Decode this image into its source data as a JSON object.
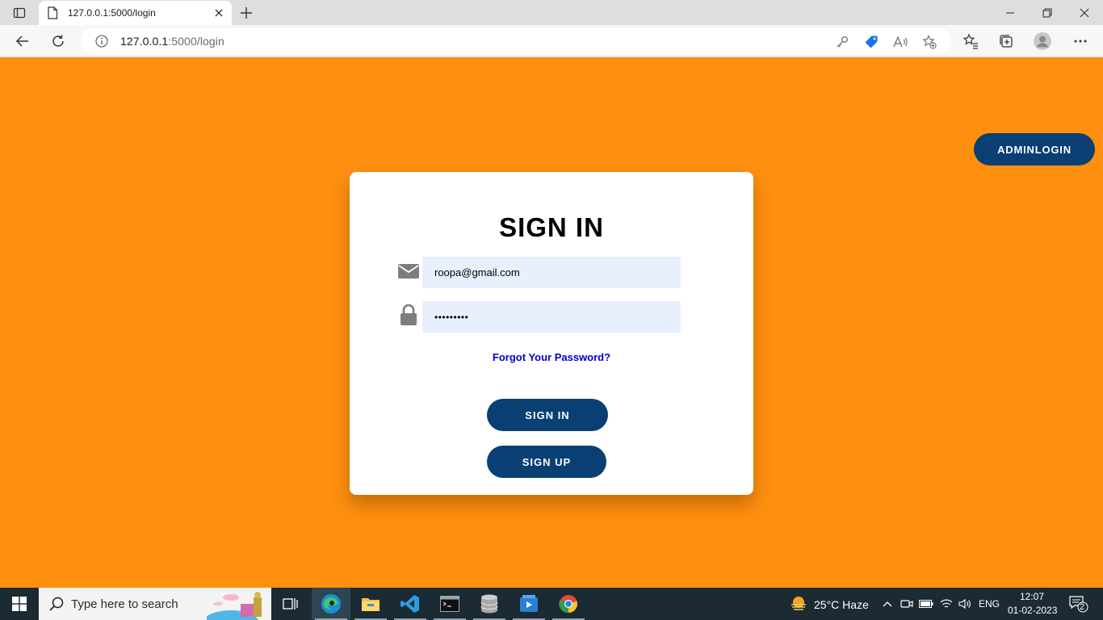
{
  "browser": {
    "tab_title": "127.0.0.1:5000/login",
    "url_host": "127.0.0.1",
    "url_rest": ":5000/login"
  },
  "page": {
    "admin_button": "ADMINLOGIN",
    "title": "SIGN IN",
    "email_value": "roopa@gmail.com",
    "password_mask": "•••••••••",
    "forgot_link": "Forgot Your Password?",
    "signin_button": "SIGN IN",
    "signup_button": "SIGN UP"
  },
  "taskbar": {
    "search_placeholder": "Type here to search",
    "weather": "25°C  Haze",
    "language": "ENG",
    "time": "12:07",
    "date": "01-02-2023",
    "notification_count": "2"
  },
  "colors": {
    "page_background": "#ff8f0f",
    "button_navy": "#0a3f73",
    "input_background": "#e8f0fe",
    "link_blue": "#0000cc"
  }
}
